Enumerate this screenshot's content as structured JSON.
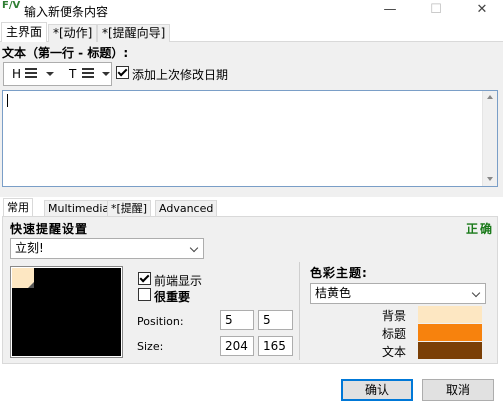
{
  "window": {
    "title": "输入新便条内容",
    "app_icon_text": "F/V",
    "minimize_glyph": "—",
    "maximize_glyph": "☐",
    "close_glyph": "✕"
  },
  "top_tabs": [
    "主界面",
    "*[动作]",
    "*[提醒向导]"
  ],
  "text_section": {
    "label": "文本（第一行 - 标题）:",
    "heading_btn": "H",
    "text_btn": "T",
    "add_date_label": "添加上次修改日期",
    "add_date_checked": true
  },
  "bottom_tabs": [
    "常用",
    "Multimedia",
    "*[提醒]",
    "Advanced"
  ],
  "quick": {
    "label": "快速提醒设置",
    "status": "正确",
    "selected": "立刻!"
  },
  "options": {
    "front_label": "前端显示",
    "front_checked": true,
    "important_label": "很重要",
    "important_checked": false,
    "position_label": "Position:",
    "position_x": "5",
    "position_y": "5",
    "size_label": "Size:",
    "size_w": "204",
    "size_h": "165"
  },
  "theme": {
    "label": "色彩主题:",
    "selected": "桔黄色",
    "items": [
      {
        "label": "背景",
        "color": "#fde7c2"
      },
      {
        "label": "标题",
        "color": "#f7820d"
      },
      {
        "label": "文本",
        "color": "#7a3f06"
      }
    ]
  },
  "buttons": {
    "confirm": "确认",
    "cancel": "取消"
  },
  "colors": {
    "accent": "#0078d7",
    "status_ok": "#1a7a1a"
  }
}
